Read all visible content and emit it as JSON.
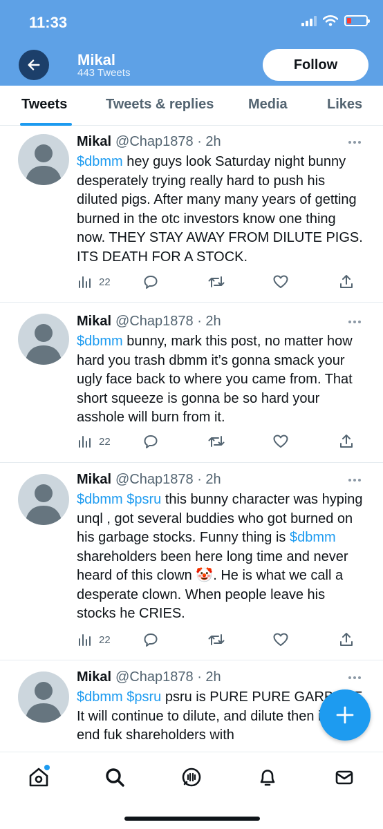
{
  "status_bar": {
    "time": "11:33"
  },
  "header": {
    "name": "Mikal",
    "tweet_count": "443 Tweets",
    "follow_label": "Follow"
  },
  "tabs": [
    {
      "label": "Tweets",
      "active": true
    },
    {
      "label": "Tweets & replies",
      "active": false
    },
    {
      "label": "Media",
      "active": false
    },
    {
      "label": "Likes",
      "active": false
    }
  ],
  "tweets": [
    {
      "name": "Mikal",
      "handle": "@Chap1878 · 2h",
      "cashtags": "$dbmm",
      "text": " hey guys look Saturday night bunny desperately trying really hard to push his diluted pigs. After many many years of getting burned in the otc investors know one thing now. THEY STAY AWAY FROM DILUTE PIGS. ITS DEATH FOR A STOCK.",
      "views": "22"
    },
    {
      "name": "Mikal",
      "handle": "@Chap1878 · 2h",
      "cashtags": "$dbmm",
      "text": " bunny, mark this post, no matter how hard you trash dbmm it’s gonna smack your ugly  face back to  where you came from.  That short squeeze is gonna be so hard your asshole will burn from it.",
      "views": "22"
    },
    {
      "name": "Mikal",
      "handle": "@Chap1878 · 2h",
      "cashtags": "$dbmm $psru",
      "text": " this bunny character was hyping unql , got several buddies who got burned on his garbage stocks. Funny thing is ",
      "cashtag2": "$dbmm",
      "text2": " shareholders been here long time and never heard of this clown 🤡.  He is what we call a desperate clown. When people leave  his stocks he CRIES.",
      "views": "22"
    },
    {
      "name": "Mikal",
      "handle": "@Chap1878 · 2h",
      "cashtags": "$dbmm $psru",
      "text": "  psru is PURE PURE GARBAGE. It will continue to dilute, and dilute then in the end fuk shareholders with"
    }
  ],
  "icons": {
    "back": "back-arrow-icon",
    "views": "views-chart-icon",
    "reply": "reply-icon",
    "retweet": "retweet-icon",
    "like": "heart-icon",
    "share": "share-icon",
    "compose": "compose-plus-icon",
    "nav": [
      "home-icon",
      "search-icon",
      "spaces-icon",
      "notifications-icon",
      "messages-icon"
    ]
  },
  "colors": {
    "header": "#5ea1e6",
    "accent": "#1d9bf0",
    "avatar": "#ccd6dd"
  }
}
